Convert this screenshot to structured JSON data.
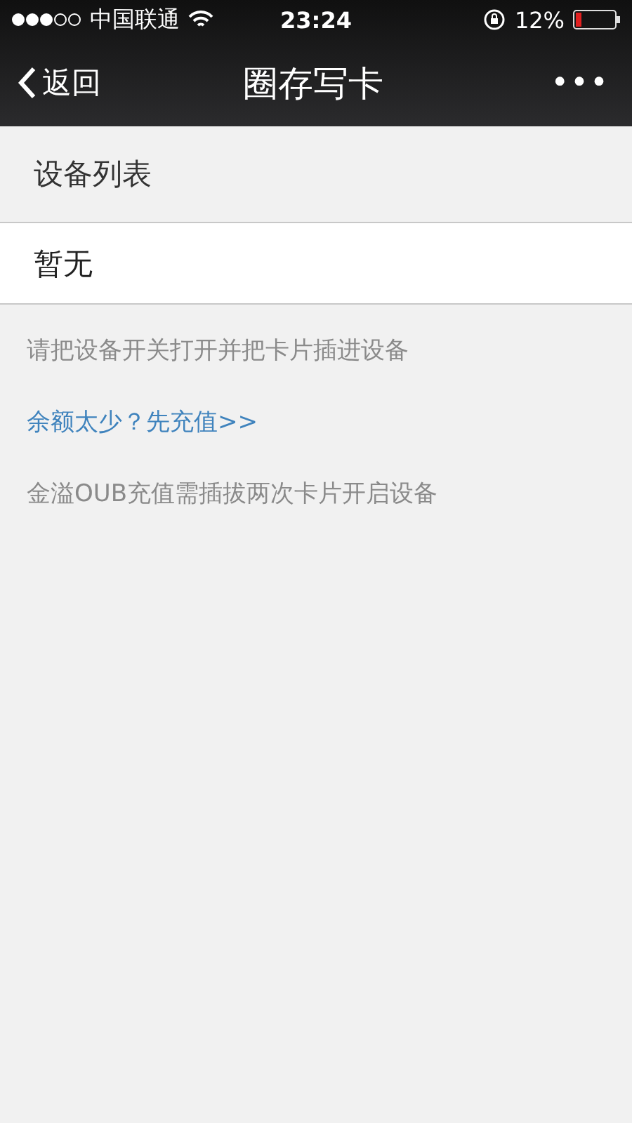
{
  "status_bar": {
    "carrier": "中国联通",
    "time": "23:24",
    "battery": "12%"
  },
  "nav_bar": {
    "back": "返回",
    "title": "圈存写卡",
    "more": "•••"
  },
  "section": {
    "title": "设备列表"
  },
  "devices": [
    {
      "name": "暂无"
    }
  ],
  "notes": [
    {
      "kind": "hint",
      "text": "请把设备开关打开并把卡片插进设备"
    },
    {
      "kind": "link",
      "text": "余额太少？先充值>>"
    },
    {
      "kind": "hint",
      "text": "金溢OUB充值需插拔两次卡片开启设备"
    }
  ]
}
